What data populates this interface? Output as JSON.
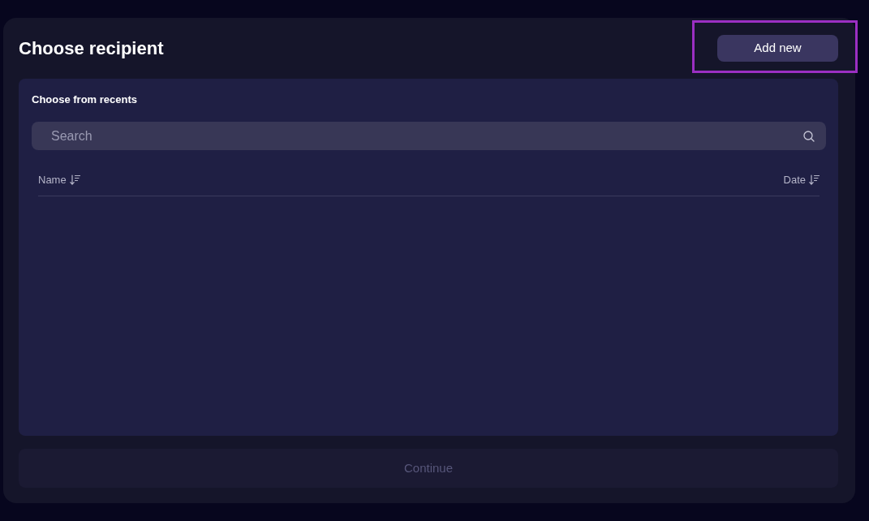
{
  "header": {
    "title": "Choose recipient",
    "add_button": {
      "label": "Add new",
      "highlighted": true
    }
  },
  "recents": {
    "heading": "Choose from recents",
    "search": {
      "placeholder": "Search"
    },
    "table": {
      "columns": [
        {
          "label": "Name"
        },
        {
          "label": "Date"
        }
      ]
    }
  },
  "continue_button": {
    "label": "Continue",
    "disabled": true
  }
}
